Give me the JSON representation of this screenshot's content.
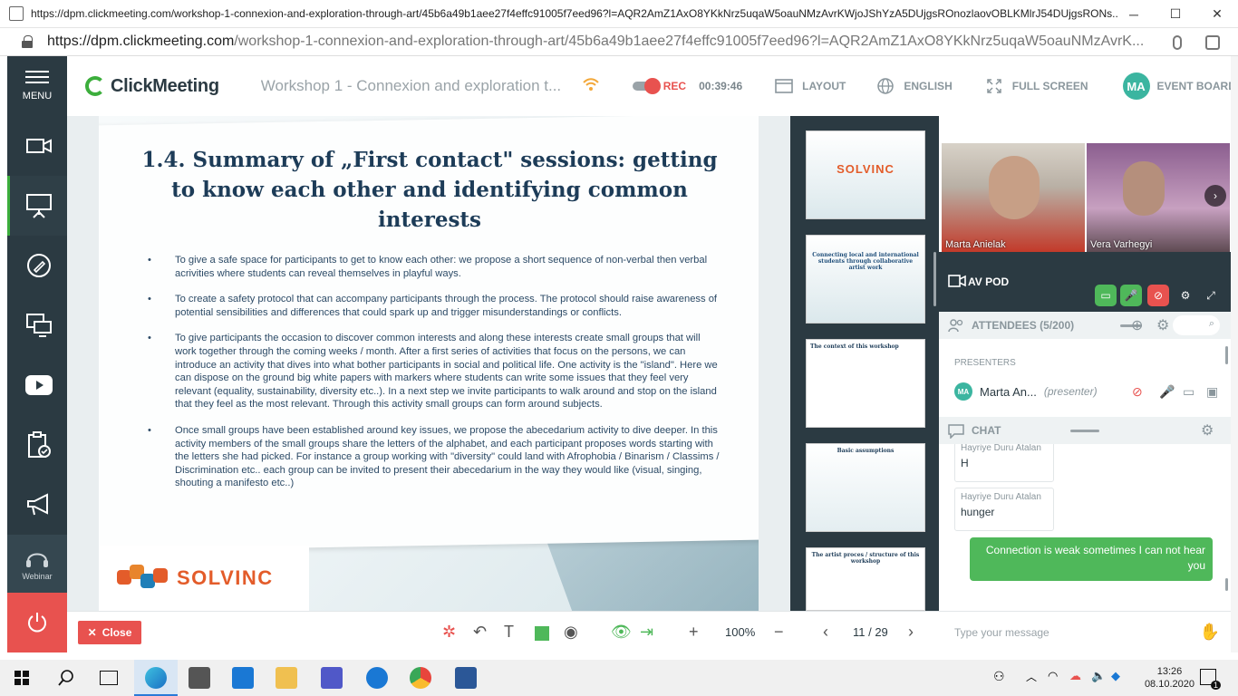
{
  "window": {
    "title": "https://dpm.clickmeeting.com/workshop-1-connexion-and-exploration-through-art/45b6a49b1aee27f4effc91005f7eed96?l=AQR2AmZ1AxO8YKkNrz5uqaW5oauNMzAvrKWjoJShYzA5DUjgsROnozlaovOBLKMlrJ54DUjgsRONs...",
    "minimize": "─",
    "maximize": "☐",
    "close": "✕"
  },
  "address": {
    "host": "https://dpm.clickmeeting.com",
    "path": "/workshop-1-connexion-and-exploration-through-art/45b6a49b1aee27f4effc91005f7eed96?l=AQR2AmZ1AxO8YKkNrz5uqaW5oauNMzAvrK..."
  },
  "sidebar": {
    "menu_label": "MENU",
    "webinar_label": "Webinar",
    "items": [
      "camera-icon",
      "presentation-icon",
      "pen-icon",
      "desktop-share-icon",
      "youtube-icon",
      "poll-icon",
      "megaphone-icon"
    ]
  },
  "header": {
    "brand": "ClickMeeting",
    "meeting_title": "Workshop 1 - Connexion and exploration t...",
    "rec_label": "REC",
    "rec_time": "00:39:46",
    "layout_label": "LAYOUT",
    "language_label": "ENGLISH",
    "fullscreen_label": "FULL SCREEN",
    "avatar_initials": "MA",
    "event_board_label": "EVENT BOARD"
  },
  "slide": {
    "title": "1.4. Summary of „First contact\" sessions: getting to know each other and identifying common interests",
    "bullets": [
      "To give a safe space for participants to get to know each other: we propose a short sequence of non-verbal then verbal acrivities where students can reveal themselves in playful ways.",
      "To create a safety protocol that can accompany participants through the process. The protocol should raise awareness of potential sensibilities and differences that could spark up and trigger misunderstandings or conflicts.",
      "To give participants the occasion to discover common interests and along these interests create small groups that will work together through the coming weeks / month. After a first series of activities that focus on the persons, we can introduce an activity that dives into what bother participants in social and political life. One activity is the \"island\". Here we can dispose on the ground big white papers with markers where students can write some issues that they feel very relevant (equality, sustainability, diversity etc..). In a next step we invite participants to walk around and stop on the island that they feel as the most relevant. Through this activity small groups can form around subjects.",
      "Once small groups have been established around key issues, we propose the abecedarium activity to dive deeper.  In this activity members of the small groups share the letters of the alphabet, and each participant proposes words starting with the letters she had picked.  For instance a group working with \"diversity\" could land with Afrophobia / Binarism / Classims / Discrimination etc.. each group can be invited to present their abecedarium in the way they would like (visual, singing, shouting a manifesto etc..)"
    ],
    "logo_text": "SOLVINC"
  },
  "thumbnails": [
    {
      "title": "SOLVINC"
    },
    {
      "title": "Connecting local and international students through collaborative artist work"
    },
    {
      "title": "The context of this workshop"
    },
    {
      "title": "Basic assumptions"
    },
    {
      "title": "The artist proces / structure of this workshop"
    }
  ],
  "video": {
    "participants": [
      {
        "name": "Marta Anielak"
      },
      {
        "name": "Vera Varhegyi"
      }
    ]
  },
  "av_pod": {
    "label": "AV POD"
  },
  "attendees": {
    "label": "ATTENDEES (5/200)",
    "section_label": "PRESENTERS",
    "presenter_initials": "MA",
    "presenter_name": "Marta An...",
    "presenter_role": "(presenter)"
  },
  "chat": {
    "label": "CHAT",
    "messages": [
      {
        "from": "Hayriye Duru Atalan",
        "text": "H"
      },
      {
        "from": "Hayriye Duru Atalan",
        "text": "hunger"
      }
    ],
    "outgoing": "Connection is weak sometimes I can not hear you",
    "placeholder": "Type your message"
  },
  "toolbar": {
    "close_label": "Close",
    "zoom": "100%",
    "page": "11 / 29"
  },
  "taskbar": {
    "time": "13:26",
    "date": "08.10.2020",
    "notifications": "1"
  }
}
